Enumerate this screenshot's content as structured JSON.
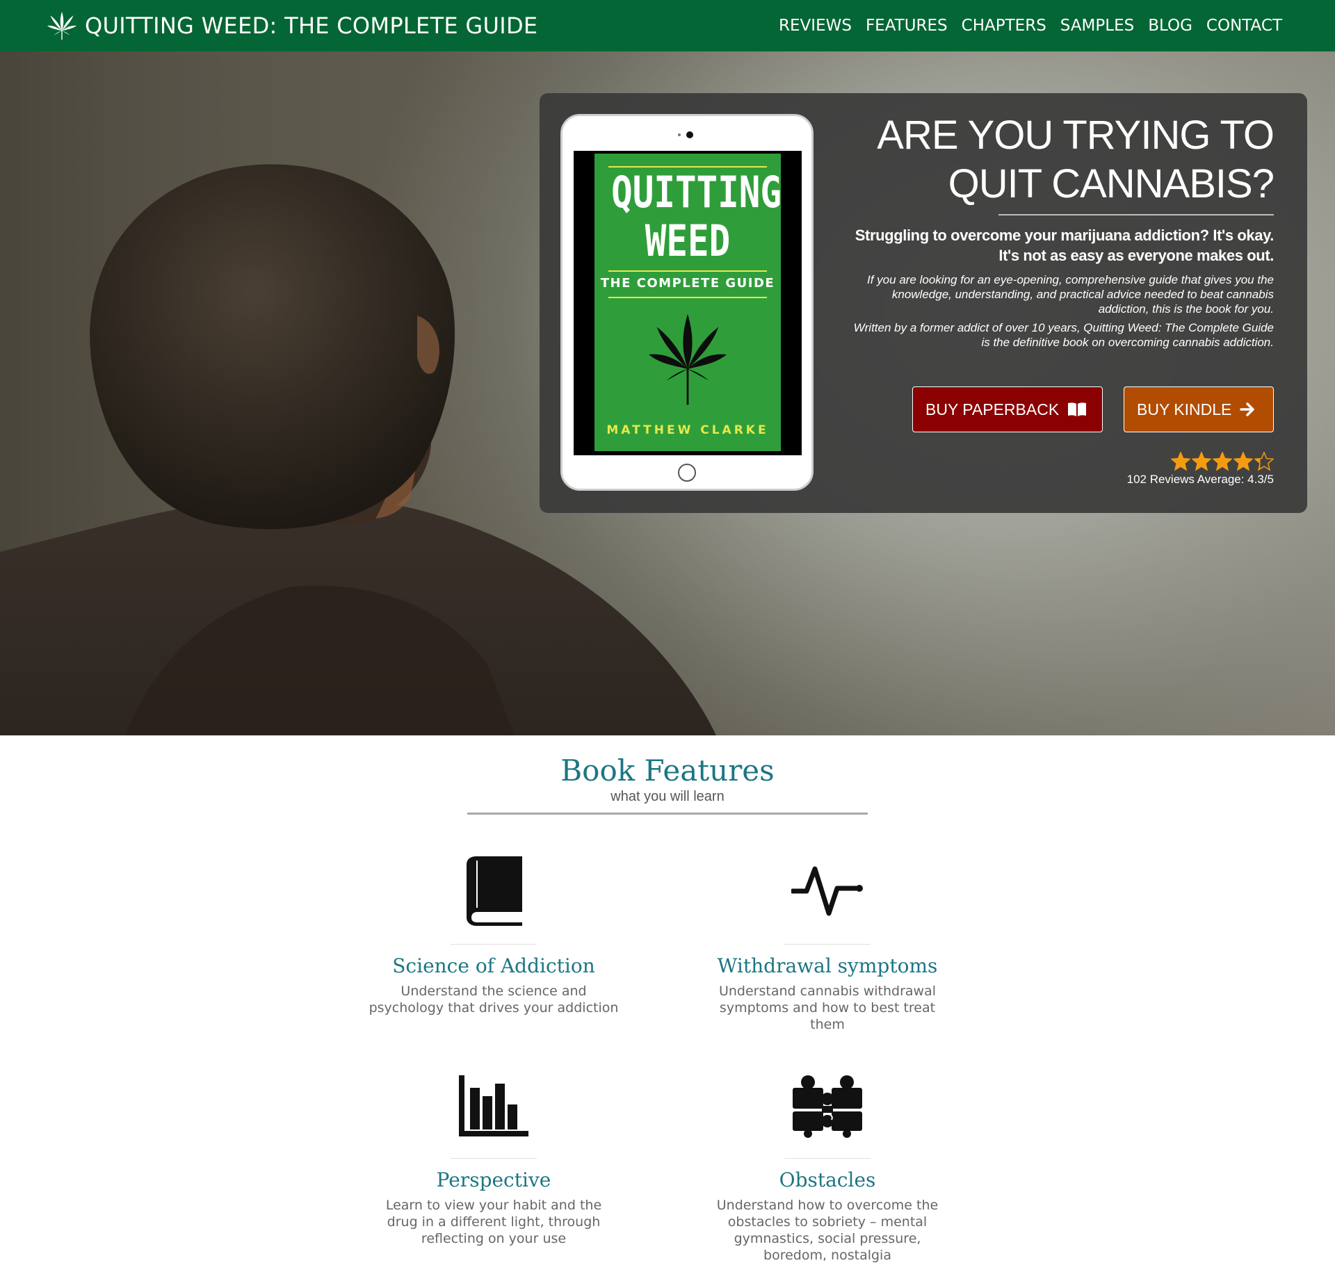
{
  "brand": {
    "title": "QUITTING WEED: THE COMPLETE GUIDE",
    "logo_icon": "cannabis-leaf-icon"
  },
  "nav": [
    {
      "label": "REVIEWS"
    },
    {
      "label": "FEATURES"
    },
    {
      "label": "CHAPTERS"
    },
    {
      "label": "SAMPLES"
    },
    {
      "label": "BLOG"
    },
    {
      "label": "CONTACT"
    }
  ],
  "hero": {
    "heading_line1": "ARE YOU TRYING TO",
    "heading_line2": "QUIT CANNABIS?",
    "subheading": "Struggling to overcome your marijuana addiction? It's okay. It's not as easy as everyone makes out.",
    "paragraph1": "If you are looking for an eye-opening, comprehensive guide that gives you the knowledge, understanding, and practical advice needed to beat cannabis addiction, this is the book for you.",
    "paragraph2": "Written by a former addict of over 10 years, Quitting Weed: The Complete Guide is the definitive book on overcoming cannabis addiction.",
    "buy_paperback": "BUY PAPERBACK",
    "buy_kindle": "BUY KINDLE",
    "rating_value": 4.3,
    "rating_max": 5,
    "reviews_text": "102 Reviews Average: 4.3/5"
  },
  "book_cover": {
    "title_line1": "QUITTING",
    "title_line2": "WEED",
    "subtitle": "THE COMPLETE GUIDE",
    "author": "MATTHEW CLARKE"
  },
  "features": {
    "title": "Book Features",
    "subtitle": "what you will learn",
    "items": [
      {
        "icon": "book-icon",
        "title": "Science of Addiction",
        "desc": "Understand the science and psychology that drives your addiction"
      },
      {
        "icon": "pulse-icon",
        "title": "Withdrawal symptoms",
        "desc": "Understand cannabis withdrawal symptoms and how to best treat them"
      },
      {
        "icon": "bar-chart-icon",
        "title": "Perspective",
        "desc": "Learn to view your habit and the drug in a different light, through reflecting on your use"
      },
      {
        "icon": "puzzle-icon",
        "title": "Obstacles",
        "desc": "Understand how to overcome the obstacles to sobriety – mental gymnastics, social pressure, boredom, nostalgia"
      }
    ]
  },
  "colors": {
    "navbar": "#046634",
    "paperback_button": "#8b0000",
    "kindle_button": "#b14c00",
    "feature_title": "#1c7684",
    "star": "#f39c12"
  }
}
